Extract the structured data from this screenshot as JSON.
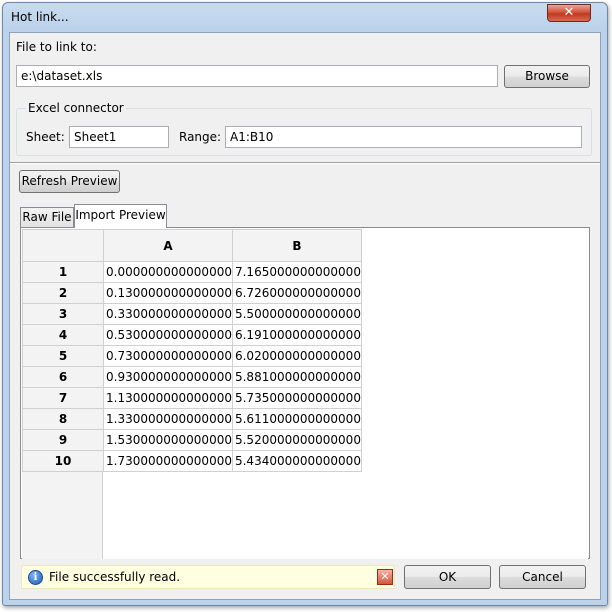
{
  "window": {
    "title": "Hot link...",
    "close_glyph": "✕"
  },
  "file": {
    "label": "File to link to:",
    "path": "e:\\dataset.xls",
    "browse_label": "Browse"
  },
  "excel": {
    "group_label": "Excel connector",
    "sheet_label": "Sheet:",
    "sheet_value": "Sheet1",
    "range_label": "Range:",
    "range_value": "A1:B10"
  },
  "refresh_label": "Refresh Preview",
  "tabs": [
    {
      "label": "Raw File",
      "active": false
    },
    {
      "label": "Import Preview",
      "active": true
    }
  ],
  "grid": {
    "columns": [
      "A",
      "B"
    ],
    "rows": [
      {
        "n": "1",
        "a": "0.000000000000000",
        "b": "7.165000000000000"
      },
      {
        "n": "2",
        "a": "0.130000000000000",
        "b": "6.726000000000000"
      },
      {
        "n": "3",
        "a": "0.330000000000000",
        "b": "5.500000000000000"
      },
      {
        "n": "4",
        "a": "0.530000000000000",
        "b": "6.191000000000000"
      },
      {
        "n": "5",
        "a": "0.730000000000000",
        "b": "6.020000000000000"
      },
      {
        "n": "6",
        "a": "0.930000000000000",
        "b": "5.881000000000000"
      },
      {
        "n": "7",
        "a": "1.130000000000000",
        "b": "5.735000000000000"
      },
      {
        "n": "8",
        "a": "1.330000000000000",
        "b": "5.611000000000000"
      },
      {
        "n": "9",
        "a": "1.530000000000000",
        "b": "5.520000000000000"
      },
      {
        "n": "10",
        "a": "1.730000000000000",
        "b": "5.434000000000000"
      }
    ]
  },
  "status": {
    "icon": "info-icon",
    "text": "File successfully read."
  },
  "ok_label": "OK",
  "cancel_label": "Cancel",
  "colors": {
    "status_background": "#ffffe1",
    "accent": "#1c5db8"
  }
}
